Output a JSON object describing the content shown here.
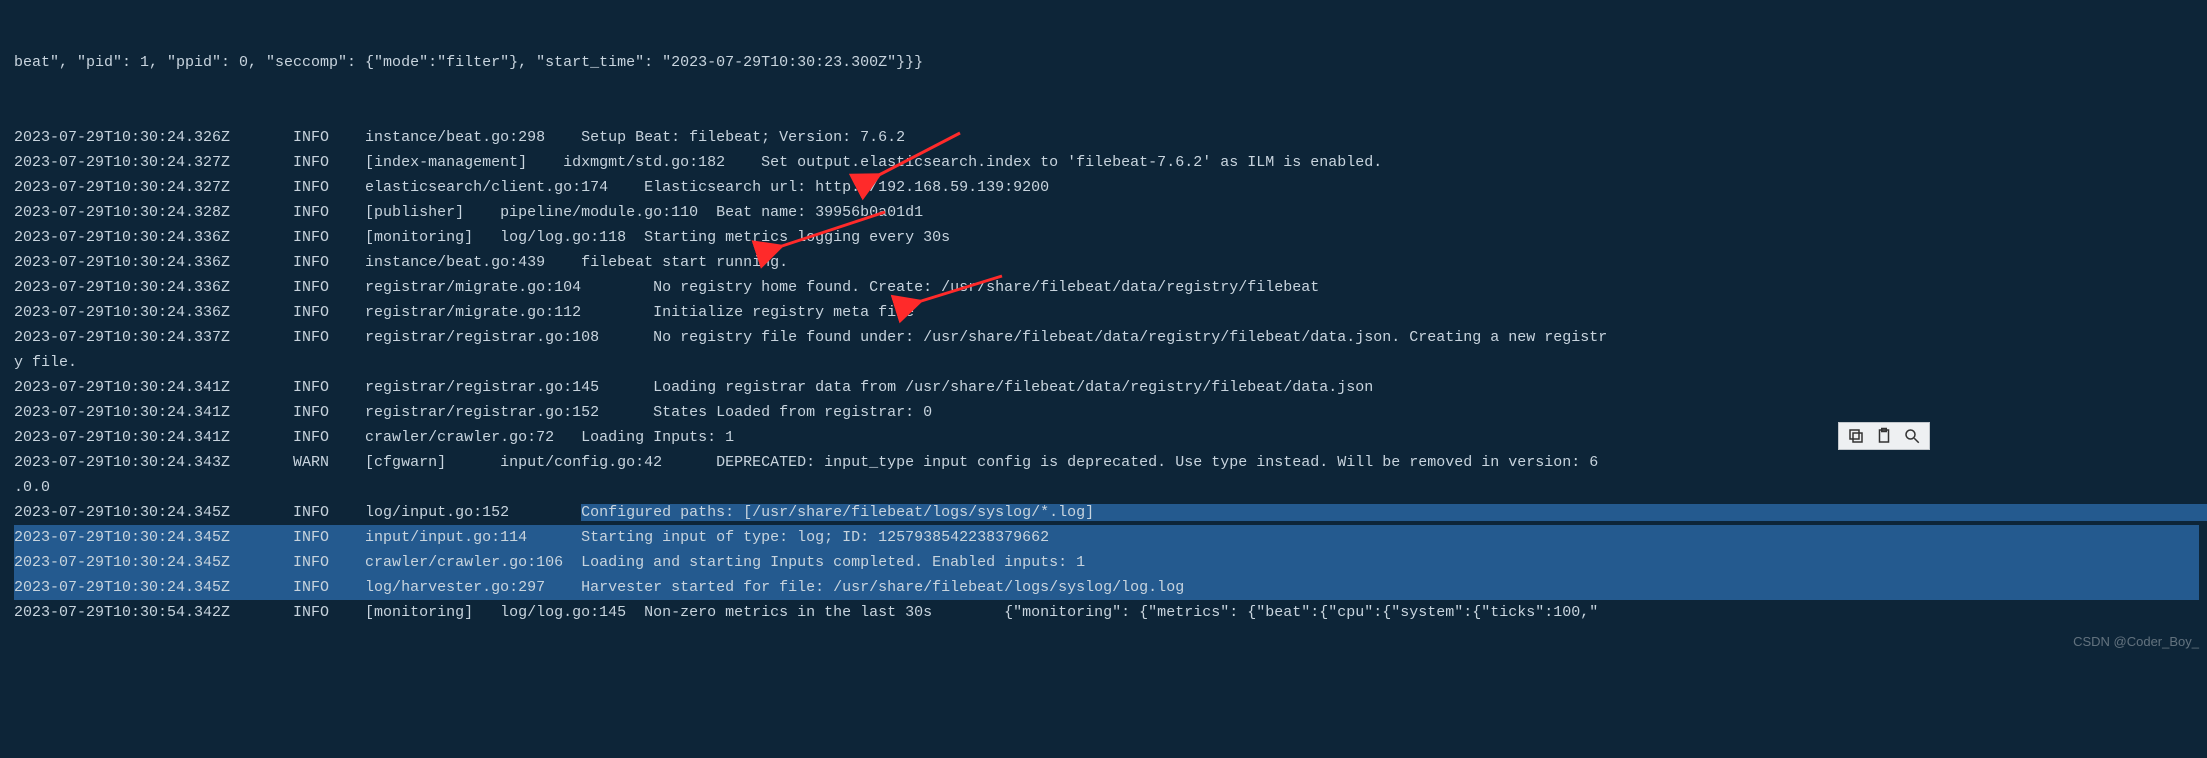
{
  "partial_top": "beat\", \"pid\": 1, \"ppid\": 0, \"seccomp\": {\"mode\":\"filter\"}, \"start_time\": \"2023-07-29T10:30:23.300Z\"}}}",
  "lines": [
    {
      "ts": "2023-07-29T10:30:24.326Z",
      "lvl": "INFO",
      "src": "instance/beat.go:298",
      "pad_after_src": "    ",
      "msg": "Setup Beat: filebeat; Version: 7.6.2"
    },
    {
      "ts": "2023-07-29T10:30:24.327Z",
      "lvl": "INFO",
      "src": "[index-management]",
      "pad_after_src": "    ",
      "msg": "idxmgmt/std.go:182    Set output.elasticsearch.index to 'filebeat-7.6.2' as ILM is enabled."
    },
    {
      "ts": "2023-07-29T10:30:24.327Z",
      "lvl": "INFO",
      "src": "elasticsearch/client.go:174",
      "pad_after_src": "    ",
      "msg": "Elasticsearch url: http://192.168.59.139:9200"
    },
    {
      "ts": "2023-07-29T10:30:24.328Z",
      "lvl": "INFO",
      "src": "[publisher]",
      "pad_after_src": "    ",
      "msg": "pipeline/module.go:110  Beat name: 39956b0a01d1"
    },
    {
      "ts": "2023-07-29T10:30:24.336Z",
      "lvl": "INFO",
      "src": "[monitoring]",
      "pad_after_src": "   ",
      "msg": "log/log.go:118  Starting metrics logging every 30s"
    },
    {
      "ts": "2023-07-29T10:30:24.336Z",
      "lvl": "INFO",
      "src": "instance/beat.go:439",
      "pad_after_src": "    ",
      "msg": "filebeat start running."
    },
    {
      "ts": "2023-07-29T10:30:24.336Z",
      "lvl": "INFO",
      "src": "registrar/migrate.go:104",
      "pad_after_src": "        ",
      "msg": "No registry home found. Create: /usr/share/filebeat/data/registry/filebeat"
    },
    {
      "ts": "2023-07-29T10:30:24.336Z",
      "lvl": "INFO",
      "src": "registrar/migrate.go:112",
      "pad_after_src": "        ",
      "msg": "Initialize registry meta file"
    },
    {
      "ts": "2023-07-29T10:30:24.337Z",
      "lvl": "INFO",
      "src": "registrar/registrar.go:108",
      "pad_after_src": "      ",
      "msg": "No registry file found under: /usr/share/filebeat/data/registry/filebeat/data.json. Creating a new registr",
      "wrap": "y file."
    },
    {
      "ts": "2023-07-29T10:30:24.341Z",
      "lvl": "INFO",
      "src": "registrar/registrar.go:145",
      "pad_after_src": "      ",
      "msg": "Loading registrar data from /usr/share/filebeat/data/registry/filebeat/data.json"
    },
    {
      "ts": "2023-07-29T10:30:24.341Z",
      "lvl": "INFO",
      "src": "registrar/registrar.go:152",
      "pad_after_src": "      ",
      "msg": "States Loaded from registrar: 0"
    },
    {
      "ts": "2023-07-29T10:30:24.341Z",
      "lvl": "INFO",
      "src": "crawler/crawler.go:72",
      "pad_after_src": "   ",
      "msg": "Loading Inputs: 1"
    },
    {
      "ts": "2023-07-29T10:30:24.343Z",
      "lvl": "WARN",
      "src": "[cfgwarn]",
      "pad_after_src": "      ",
      "msg": "input/config.go:42      DEPRECATED: input_type input config is deprecated. Use type instead. Will be removed in version: 6",
      "wrap": ".0.0"
    },
    {
      "ts": "2023-07-29T10:30:24.345Z",
      "lvl": "INFO",
      "src": "log/input.go:152",
      "pad_after_src": "        ",
      "msg": "Configured paths: [/usr/share/filebeat/logs/syslog/*.log]",
      "sel": "msg_to_end"
    },
    {
      "ts": "2023-07-29T10:30:24.345Z",
      "lvl": "INFO",
      "src": "input/input.go:114",
      "pad_after_src": "      ",
      "msg": "Starting input of type: log; ID: 1257938542238379662",
      "sel": "full"
    },
    {
      "ts": "2023-07-29T10:30:24.345Z",
      "lvl": "INFO",
      "src": "crawler/crawler.go:106",
      "pad_after_src": "  ",
      "msg": "Loading and starting Inputs completed. Enabled inputs: 1",
      "sel": "full"
    },
    {
      "ts": "2023-07-29T10:30:24.345Z",
      "lvl": "INFO",
      "src": "log/harvester.go:297",
      "pad_after_src": "    ",
      "msg": "Harvester started for file: /usr/share/filebeat/logs/syslog/log.log",
      "sel": "full"
    },
    {
      "ts": "2023-07-29T10:30:54.342Z",
      "lvl": "INFO",
      "src": "[monitoring]",
      "pad_after_src": "   ",
      "msg": "log/log.go:145  Non-zero metrics in the last 30s        {\"monitoring\": {\"metrics\": {\"beat\":{\"cpu\":{\"system\":{\"ticks\":100,\""
    }
  ],
  "gap_ts_lvl": "       ",
  "gap_lvl_src": "    ",
  "watermark": "CSDN @Coder_Boy_",
  "toolbar": {
    "copy": "copy-icon",
    "paste": "paste-icon",
    "search": "search-icon"
  }
}
